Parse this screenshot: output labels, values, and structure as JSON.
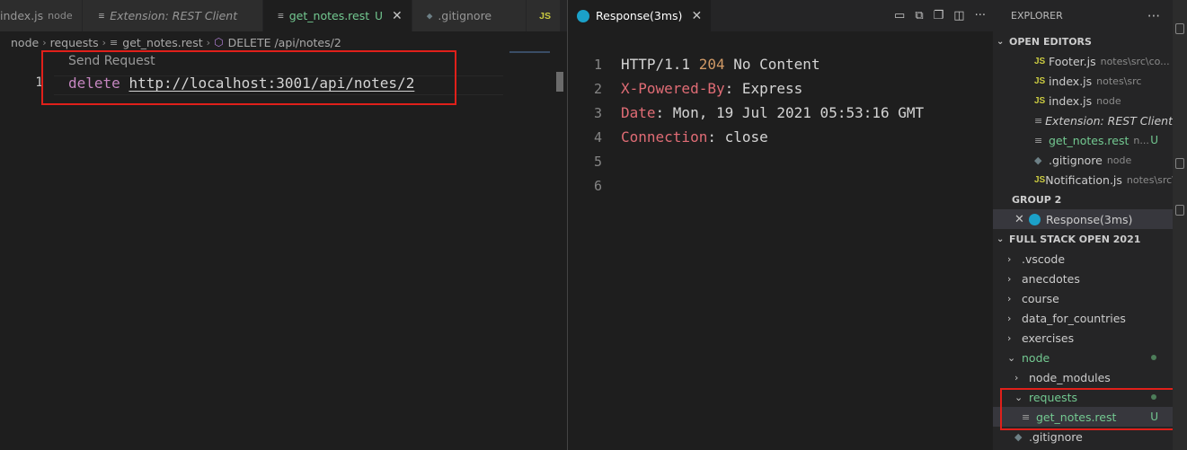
{
  "left_tabs": [
    {
      "label": "index.js",
      "desc": "node"
    },
    {
      "label": "Extension: REST Client"
    },
    {
      "label": "get_notes.rest",
      "mark": "U"
    },
    {
      "label": ".gitignore"
    },
    {
      "label": "JS"
    }
  ],
  "left_tab_more": "···",
  "breadcrumb": [
    "node",
    "requests",
    "get_notes.rest",
    "DELETE /api/notes/2"
  ],
  "editor": {
    "codelens": "Send Request",
    "line_number": "1",
    "keyword": "delete",
    "url": "http://localhost:3001/api/notes/2"
  },
  "response_tab": {
    "label": "Response(3ms)",
    "close": "✕"
  },
  "response_lines": [
    {
      "num": "1",
      "parts": [
        {
          "t": "HTTP/1.1 ",
          "c": "txt"
        },
        {
          "t": "204",
          "c": "status"
        },
        {
          "t": " No Content",
          "c": "txt"
        }
      ]
    },
    {
      "num": "2",
      "parts": [
        {
          "t": "X-Powered-By",
          "c": "hdr"
        },
        {
          "t": ": Express",
          "c": "txt"
        }
      ]
    },
    {
      "num": "3",
      "parts": [
        {
          "t": "Date",
          "c": "hdr"
        },
        {
          "t": ": Mon, 19 Jul 2021 05:53:16 GMT",
          "c": "txt"
        }
      ]
    },
    {
      "num": "4",
      "parts": [
        {
          "t": "Connection",
          "c": "hdr"
        },
        {
          "t": ": close",
          "c": "txt"
        }
      ]
    },
    {
      "num": "5",
      "parts": []
    },
    {
      "num": "6",
      "parts": []
    }
  ],
  "explorer": {
    "title": "EXPLORER",
    "more": "···",
    "open_editors_title": "OPEN EDITORS",
    "open_editors": [
      {
        "icon": "JS",
        "label": "Footer.js",
        "desc": "notes\\src\\co..."
      },
      {
        "icon": "JS",
        "label": "index.js",
        "desc": "notes\\src"
      },
      {
        "icon": "JS",
        "label": "index.js",
        "desc": "node"
      },
      {
        "icon": "lines",
        "label": "Extension: REST Client",
        "italic": true
      },
      {
        "icon": "lines",
        "label": "get_notes.rest",
        "desc": "n...",
        "badge": "U",
        "green": true
      },
      {
        "icon": "diamond",
        "label": ".gitignore",
        "desc": "node"
      },
      {
        "icon": "JS",
        "label": "Notification.js",
        "desc": "notes\\src\\..."
      }
    ],
    "group2_title": "GROUP 2",
    "group2_item": "Response(3ms)",
    "project_title": "FULL STACK OPEN 2021",
    "tree": [
      {
        "label": ".vscode",
        "depth": 0,
        "chev": "›"
      },
      {
        "label": "anecdotes",
        "depth": 0,
        "chev": "›"
      },
      {
        "label": "course",
        "depth": 0,
        "chev": "›"
      },
      {
        "label": "data_for_countries",
        "depth": 0,
        "chev": "›"
      },
      {
        "label": "exercises",
        "depth": 0,
        "chev": "›"
      },
      {
        "label": "node",
        "depth": 0,
        "chev": "⌄",
        "green": true,
        "dot": true
      },
      {
        "label": "node_modules",
        "depth": 1,
        "chev": "›"
      },
      {
        "label": "requests",
        "depth": 1,
        "chev": "⌄",
        "green": true,
        "dot": true
      },
      {
        "label": "get_notes.rest",
        "depth": 2,
        "file": "lines",
        "green": true,
        "badge": "U",
        "selected": true
      },
      {
        "label": ".gitignore",
        "depth": 1,
        "file": "diamond"
      }
    ]
  },
  "colors": {
    "accent_red": "#e0201a",
    "git_untracked": "#73c991",
    "keyword": "#c586c0"
  }
}
